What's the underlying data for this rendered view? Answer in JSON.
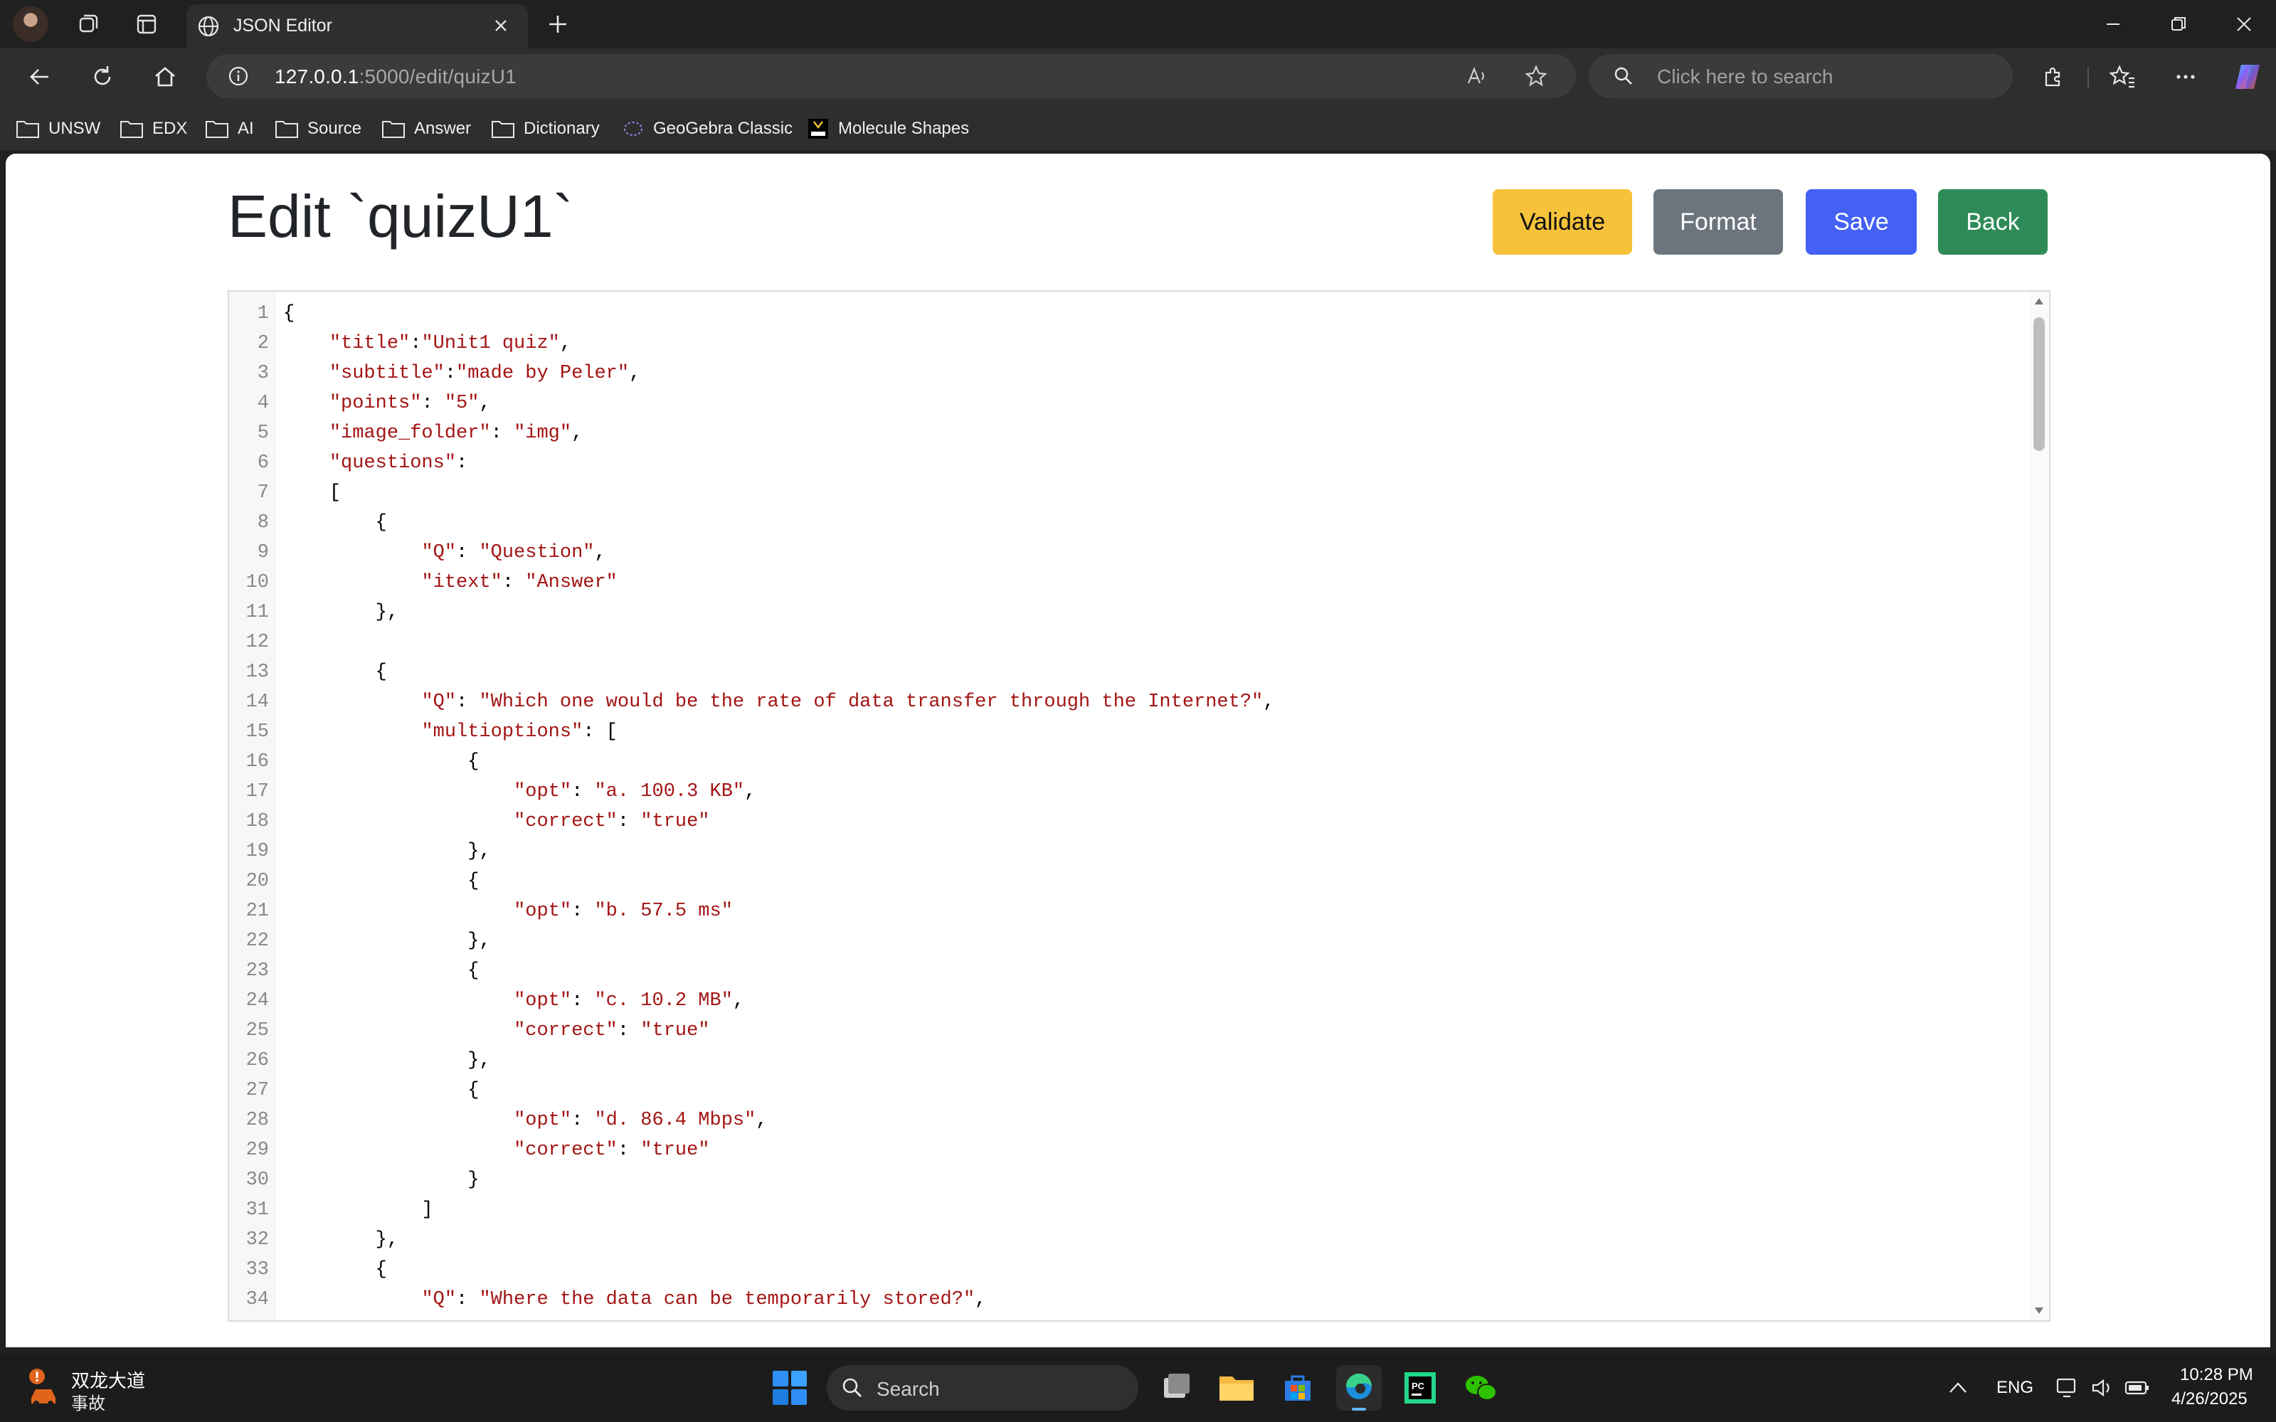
{
  "browser": {
    "tab_title": "JSON Editor",
    "url_host": "127.0.0.1",
    "url_rest": ":5000/edit/quizU1",
    "search_placeholder": "Click here to search"
  },
  "favorites": [
    "UNSW",
    "EDX",
    "AI",
    "Source",
    "Answer",
    "Dictionary",
    "GeoGebra Classic",
    "Molecule Shapes"
  ],
  "page": {
    "title": "Edit `quizU1`",
    "buttons": {
      "validate": "Validate",
      "format": "Format",
      "save": "Save",
      "back": "Back"
    }
  },
  "editor": {
    "lines": [
      {
        "n": "1",
        "indent": 0,
        "parts": [
          {
            "t": "{"
          }
        ]
      },
      {
        "n": "2",
        "indent": 1,
        "parts": [
          {
            "s": "\"title\""
          },
          {
            "t": ":"
          },
          {
            "s": "\"Unit1 quiz\""
          },
          {
            "t": ","
          }
        ]
      },
      {
        "n": "3",
        "indent": 1,
        "parts": [
          {
            "s": "\"subtitle\""
          },
          {
            "t": ":"
          },
          {
            "s": "\"made by Peler\""
          },
          {
            "t": ","
          }
        ]
      },
      {
        "n": "4",
        "indent": 1,
        "parts": [
          {
            "s": "\"points\""
          },
          {
            "t": ": "
          },
          {
            "s": "\"5\""
          },
          {
            "t": ","
          }
        ]
      },
      {
        "n": "5",
        "indent": 1,
        "parts": [
          {
            "s": "\"image_folder\""
          },
          {
            "t": ": "
          },
          {
            "s": "\"img\""
          },
          {
            "t": ","
          }
        ]
      },
      {
        "n": "6",
        "indent": 1,
        "parts": [
          {
            "s": "\"questions\""
          },
          {
            "t": ":"
          }
        ]
      },
      {
        "n": "7",
        "indent": 1,
        "parts": [
          {
            "t": "["
          }
        ]
      },
      {
        "n": "8",
        "indent": 2,
        "parts": [
          {
            "t": "{"
          }
        ]
      },
      {
        "n": "9",
        "indent": 3,
        "parts": [
          {
            "s": "\"Q\""
          },
          {
            "t": ": "
          },
          {
            "s": "\"Question\""
          },
          {
            "t": ","
          }
        ]
      },
      {
        "n": "10",
        "indent": 3,
        "parts": [
          {
            "s": "\"itext\""
          },
          {
            "t": ": "
          },
          {
            "s": "\"Answer\""
          }
        ]
      },
      {
        "n": "11",
        "indent": 2,
        "parts": [
          {
            "t": "},"
          }
        ]
      },
      {
        "n": "12",
        "indent": 0,
        "parts": []
      },
      {
        "n": "13",
        "indent": 2,
        "parts": [
          {
            "t": "{"
          }
        ]
      },
      {
        "n": "14",
        "indent": 3,
        "parts": [
          {
            "s": "\"Q\""
          },
          {
            "t": ": "
          },
          {
            "s": "\"Which one would be the rate of data transfer through the Internet?\""
          },
          {
            "t": ","
          }
        ]
      },
      {
        "n": "15",
        "indent": 3,
        "parts": [
          {
            "s": "\"multioptions\""
          },
          {
            "t": ": ["
          }
        ]
      },
      {
        "n": "16",
        "indent": 4,
        "parts": [
          {
            "t": "{"
          }
        ]
      },
      {
        "n": "17",
        "indent": 5,
        "parts": [
          {
            "s": "\"opt\""
          },
          {
            "t": ": "
          },
          {
            "s": "\"a. 100.3 KB\""
          },
          {
            "t": ","
          }
        ]
      },
      {
        "n": "18",
        "indent": 5,
        "parts": [
          {
            "s": "\"correct\""
          },
          {
            "t": ": "
          },
          {
            "s": "\"true\""
          }
        ]
      },
      {
        "n": "19",
        "indent": 4,
        "parts": [
          {
            "t": "},"
          }
        ]
      },
      {
        "n": "20",
        "indent": 4,
        "parts": [
          {
            "t": "{"
          }
        ]
      },
      {
        "n": "21",
        "indent": 5,
        "parts": [
          {
            "s": "\"opt\""
          },
          {
            "t": ": "
          },
          {
            "s": "\"b. 57.5 ms\""
          }
        ]
      },
      {
        "n": "22",
        "indent": 4,
        "parts": [
          {
            "t": "},"
          }
        ]
      },
      {
        "n": "23",
        "indent": 4,
        "parts": [
          {
            "t": "{"
          }
        ]
      },
      {
        "n": "24",
        "indent": 5,
        "parts": [
          {
            "s": "\"opt\""
          },
          {
            "t": ": "
          },
          {
            "s": "\"c. 10.2 MB\""
          },
          {
            "t": ","
          }
        ]
      },
      {
        "n": "25",
        "indent": 5,
        "parts": [
          {
            "s": "\"correct\""
          },
          {
            "t": ": "
          },
          {
            "s": "\"true\""
          }
        ]
      },
      {
        "n": "26",
        "indent": 4,
        "parts": [
          {
            "t": "},"
          }
        ]
      },
      {
        "n": "27",
        "indent": 4,
        "parts": [
          {
            "t": "{"
          }
        ]
      },
      {
        "n": "28",
        "indent": 5,
        "parts": [
          {
            "s": "\"opt\""
          },
          {
            "t": ": "
          },
          {
            "s": "\"d. 86.4 Mbps\""
          },
          {
            "t": ","
          }
        ]
      },
      {
        "n": "29",
        "indent": 5,
        "parts": [
          {
            "s": "\"correct\""
          },
          {
            "t": ": "
          },
          {
            "s": "\"true\""
          }
        ]
      },
      {
        "n": "30",
        "indent": 4,
        "parts": [
          {
            "t": "}"
          }
        ]
      },
      {
        "n": "31",
        "indent": 3,
        "parts": [
          {
            "t": "]"
          }
        ]
      },
      {
        "n": "32",
        "indent": 2,
        "parts": [
          {
            "t": "},"
          }
        ]
      },
      {
        "n": "33",
        "indent": 2,
        "parts": [
          {
            "t": "{"
          }
        ]
      },
      {
        "n": "34",
        "indent": 3,
        "parts": [
          {
            "s": "\"Q\""
          },
          {
            "t": ": "
          },
          {
            "s": "\"Where the data can be temporarily stored?\""
          },
          {
            "t": ","
          }
        ]
      }
    ]
  },
  "taskbar": {
    "weather_title": "双龙大道",
    "weather_sub": "事故",
    "search_label": "Search",
    "language": "ENG",
    "time": "10:28 PM",
    "date": "4/26/2025"
  },
  "colors": {
    "string": "#a31515",
    "validate": "#f5c23a",
    "format": "#6c757d",
    "save": "#4361f5",
    "back": "#2e8b57"
  }
}
